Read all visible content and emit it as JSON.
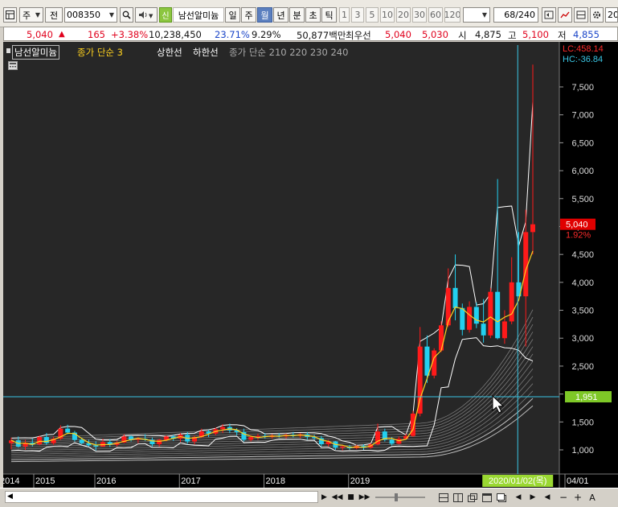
{
  "toolbar": {
    "market": "주",
    "prev_label": "전",
    "code": "008350",
    "badge": "신",
    "stock_name": "남선알미늄",
    "periods": [
      "일",
      "주",
      "월",
      "년",
      "분",
      "초",
      "틱"
    ],
    "selected_period": "월",
    "intervals": [
      "1",
      "3",
      "5",
      "10",
      "20",
      "30",
      "60",
      "120"
    ],
    "count": "68/240",
    "zoom": "20"
  },
  "quote": {
    "price": "5,040",
    "change_arrow": "▲",
    "change": "165",
    "change_pct": "+3.38%",
    "volume": "10,238,450",
    "turnover_pct": "23.71%",
    "ratio_pct": "9.29%",
    "amount": "50,877백만",
    "priority_label": "최우선",
    "bid": "5,040",
    "ask": "5,030",
    "open_label": "시",
    "open": "4,875",
    "high_label": "고",
    "high": "5,100",
    "low_label": "저",
    "low": "4,855"
  },
  "legend": {
    "name": "남선알미늄",
    "ma_label": "종가 단순 3",
    "upper_label": "상한선",
    "lower_label": "하한선",
    "long_ma_label": "종가 단순 210 220 230 240"
  },
  "colors": {
    "up": "#ff1a1a",
    "down": "#22d0f0",
    "ma": "#ffd21e",
    "envelope": "#ffffff",
    "crosshair": "#3ac6e4",
    "price_badge": "#e00000",
    "cross_badge": "#7ec827",
    "date_badge": "#9ad832"
  },
  "icons": [
    "grid-icon",
    "search-icon",
    "speaker-icon",
    "arrow-left-icon",
    "arrow-right-icon",
    "gear-icon",
    "first-icon",
    "last-icon",
    "stop-icon"
  ],
  "chart_data": {
    "type": "candlestick",
    "title": "",
    "period": "monthly",
    "x_tick_labels": [
      "2014",
      "2015",
      "2016",
      "2017",
      "2018",
      "2019",
      "04/01"
    ],
    "y_tick_labels": [
      "1,000",
      "1,500",
      "2,000",
      "2,500",
      "3,000",
      "3,500",
      "4,000",
      "4,500",
      "5,000",
      "5,500",
      "6,000",
      "6,500",
      "7,000",
      "7,500"
    ],
    "ylim": [
      600,
      8000
    ],
    "lc_label": "LC:458.14",
    "hc_label": "HC:-36.84",
    "current_price_label": "5,040",
    "current_pct_label": "1.92%",
    "crosshair_price_label": "1,951",
    "crosshair_date_label": "2020/01/02(목)",
    "crosshair_price": 1951,
    "candles": [
      {
        "date": "2013-12",
        "open": 1120,
        "high": 1220,
        "low": 1010,
        "close": 1170
      },
      {
        "date": "2014-01",
        "open": 1170,
        "high": 1240,
        "low": 1040,
        "close": 1060
      },
      {
        "date": "2014-02",
        "open": 1060,
        "high": 1180,
        "low": 1000,
        "close": 1130
      },
      {
        "date": "2014-03",
        "open": 1130,
        "high": 1200,
        "low": 1060,
        "close": 1100
      },
      {
        "date": "2014-04",
        "open": 1100,
        "high": 1260,
        "low": 1080,
        "close": 1230
      },
      {
        "date": "2014-05",
        "open": 1230,
        "high": 1300,
        "low": 1090,
        "close": 1120
      },
      {
        "date": "2014-06",
        "open": 1120,
        "high": 1240,
        "low": 1090,
        "close": 1200
      },
      {
        "date": "2014-07",
        "open": 1200,
        "high": 1440,
        "low": 1180,
        "close": 1380
      },
      {
        "date": "2014-08",
        "open": 1380,
        "high": 1450,
        "low": 1280,
        "close": 1310
      },
      {
        "date": "2014-09",
        "open": 1310,
        "high": 1340,
        "low": 1150,
        "close": 1180
      },
      {
        "date": "2014-10",
        "open": 1180,
        "high": 1220,
        "low": 1100,
        "close": 1120
      },
      {
        "date": "2014-11",
        "open": 1120,
        "high": 1180,
        "low": 1060,
        "close": 1080
      },
      {
        "date": "2014-12",
        "open": 1080,
        "high": 1150,
        "low": 990,
        "close": 1060
      },
      {
        "date": "2015-01",
        "open": 1060,
        "high": 1200,
        "low": 1050,
        "close": 1140
      },
      {
        "date": "2015-02",
        "open": 1140,
        "high": 1190,
        "low": 1050,
        "close": 1090
      },
      {
        "date": "2015-03",
        "open": 1090,
        "high": 1160,
        "low": 1060,
        "close": 1130
      },
      {
        "date": "2015-04",
        "open": 1130,
        "high": 1280,
        "low": 1120,
        "close": 1240
      },
      {
        "date": "2015-05",
        "open": 1240,
        "high": 1260,
        "low": 1150,
        "close": 1180
      },
      {
        "date": "2015-06",
        "open": 1180,
        "high": 1230,
        "low": 1120,
        "close": 1200
      },
      {
        "date": "2015-07",
        "open": 1200,
        "high": 1280,
        "low": 1160,
        "close": 1180
      },
      {
        "date": "2015-08",
        "open": 1180,
        "high": 1220,
        "low": 1060,
        "close": 1100
      },
      {
        "date": "2015-09",
        "open": 1100,
        "high": 1200,
        "low": 1060,
        "close": 1180
      },
      {
        "date": "2015-10",
        "open": 1180,
        "high": 1260,
        "low": 1150,
        "close": 1240
      },
      {
        "date": "2015-11",
        "open": 1240,
        "high": 1270,
        "low": 1160,
        "close": 1200
      },
      {
        "date": "2015-12",
        "open": 1200,
        "high": 1300,
        "low": 1140,
        "close": 1270
      },
      {
        "date": "2016-01",
        "open": 1270,
        "high": 1320,
        "low": 1110,
        "close": 1150
      },
      {
        "date": "2016-02",
        "open": 1150,
        "high": 1260,
        "low": 1100,
        "close": 1230
      },
      {
        "date": "2016-03",
        "open": 1230,
        "high": 1380,
        "low": 1210,
        "close": 1330
      },
      {
        "date": "2016-04",
        "open": 1330,
        "high": 1360,
        "low": 1230,
        "close": 1290
      },
      {
        "date": "2016-05",
        "open": 1290,
        "high": 1400,
        "low": 1260,
        "close": 1370
      },
      {
        "date": "2016-06",
        "open": 1370,
        "high": 1460,
        "low": 1300,
        "close": 1410
      },
      {
        "date": "2016-07",
        "open": 1410,
        "high": 1470,
        "low": 1300,
        "close": 1350
      },
      {
        "date": "2016-08",
        "open": 1350,
        "high": 1390,
        "low": 1260,
        "close": 1320
      },
      {
        "date": "2016-09",
        "open": 1320,
        "high": 1380,
        "low": 1150,
        "close": 1180
      },
      {
        "date": "2016-10",
        "open": 1180,
        "high": 1260,
        "low": 1150,
        "close": 1230
      },
      {
        "date": "2016-11",
        "open": 1230,
        "high": 1290,
        "low": 1180,
        "close": 1250
      },
      {
        "date": "2016-12",
        "open": 1250,
        "high": 1300,
        "low": 1200,
        "close": 1230
      },
      {
        "date": "2017-01",
        "open": 1230,
        "high": 1280,
        "low": 1200,
        "close": 1260
      },
      {
        "date": "2017-02",
        "open": 1260,
        "high": 1300,
        "low": 1220,
        "close": 1240
      },
      {
        "date": "2017-03",
        "open": 1240,
        "high": 1290,
        "low": 1200,
        "close": 1270
      },
      {
        "date": "2017-04",
        "open": 1270,
        "high": 1320,
        "low": 1220,
        "close": 1250
      },
      {
        "date": "2017-05",
        "open": 1250,
        "high": 1300,
        "low": 1210,
        "close": 1280
      },
      {
        "date": "2017-06",
        "open": 1280,
        "high": 1320,
        "low": 1180,
        "close": 1230
      },
      {
        "date": "2017-07",
        "open": 1230,
        "high": 1270,
        "low": 1180,
        "close": 1210
      },
      {
        "date": "2017-08",
        "open": 1210,
        "high": 1250,
        "low": 1060,
        "close": 1100
      },
      {
        "date": "2017-09",
        "open": 1100,
        "high": 1180,
        "low": 1060,
        "close": 1150
      },
      {
        "date": "2017-10",
        "open": 1150,
        "high": 1160,
        "low": 1000,
        "close": 1040
      },
      {
        "date": "2017-11",
        "open": 1040,
        "high": 1080,
        "low": 990,
        "close": 1060
      },
      {
        "date": "2017-12",
        "open": 1060,
        "high": 1090,
        "low": 1000,
        "close": 1030
      },
      {
        "date": "2018-01",
        "open": 1030,
        "high": 1090,
        "low": 1010,
        "close": 1070
      },
      {
        "date": "2018-02",
        "open": 1070,
        "high": 1100,
        "low": 1000,
        "close": 1040
      },
      {
        "date": "2018-03",
        "open": 1040,
        "high": 1120,
        "low": 1020,
        "close": 1100
      },
      {
        "date": "2018-04",
        "open": 1100,
        "high": 1470,
        "low": 1080,
        "close": 1330
      },
      {
        "date": "2018-05",
        "open": 1330,
        "high": 1380,
        "low": 1150,
        "close": 1180
      },
      {
        "date": "2018-06",
        "open": 1180,
        "high": 1230,
        "low": 1080,
        "close": 1110
      },
      {
        "date": "2018-07",
        "open": 1110,
        "high": 1240,
        "low": 1100,
        "close": 1200
      },
      {
        "date": "2018-08",
        "open": 1200,
        "high": 1290,
        "low": 1180,
        "close": 1250
      },
      {
        "date": "2018-09",
        "open": 1250,
        "high": 1700,
        "low": 1230,
        "close": 1650
      },
      {
        "date": "2018-10",
        "open": 1650,
        "high": 3200,
        "low": 1600,
        "close": 2850
      },
      {
        "date": "2018-11",
        "open": 2850,
        "high": 3050,
        "low": 2200,
        "close": 2330
      },
      {
        "date": "2018-12",
        "open": 2330,
        "high": 2820,
        "low": 2280,
        "close": 2780
      },
      {
        "date": "2019-01",
        "open": 2780,
        "high": 3300,
        "low": 2750,
        "close": 3230
      },
      {
        "date": "2019-02",
        "open": 3230,
        "high": 4250,
        "low": 3200,
        "close": 3900
      },
      {
        "date": "2019-03",
        "open": 3900,
        "high": 4500,
        "low": 3320,
        "close": 3540
      },
      {
        "date": "2019-04",
        "open": 3540,
        "high": 3620,
        "low": 3050,
        "close": 3150
      },
      {
        "date": "2019-05",
        "open": 3150,
        "high": 3660,
        "low": 3100,
        "close": 3560
      },
      {
        "date": "2019-06",
        "open": 3560,
        "high": 3640,
        "low": 3180,
        "close": 3260
      },
      {
        "date": "2019-07",
        "open": 3260,
        "high": 3700,
        "low": 2920,
        "close": 3050
      },
      {
        "date": "2019-08",
        "open": 3050,
        "high": 3900,
        "low": 3000,
        "close": 3830
      },
      {
        "date": "2019-09",
        "open": 3830,
        "high": 5850,
        "low": 2980,
        "close": 3000
      },
      {
        "date": "2019-10",
        "open": 3000,
        "high": 3500,
        "low": 2900,
        "close": 3300
      },
      {
        "date": "2019-11",
        "open": 3300,
        "high": 4450,
        "low": 3250,
        "close": 4000
      },
      {
        "date": "2019-12",
        "open": 4000,
        "high": 4900,
        "low": 3750,
        "close": 3750
      },
      {
        "date": "2020-01",
        "open": 3750,
        "high": 5300,
        "low": 2850,
        "close": 4900
      },
      {
        "date": "2020-02",
        "open": 4900,
        "high": 7900,
        "low": 4500,
        "close": 5040
      }
    ]
  }
}
